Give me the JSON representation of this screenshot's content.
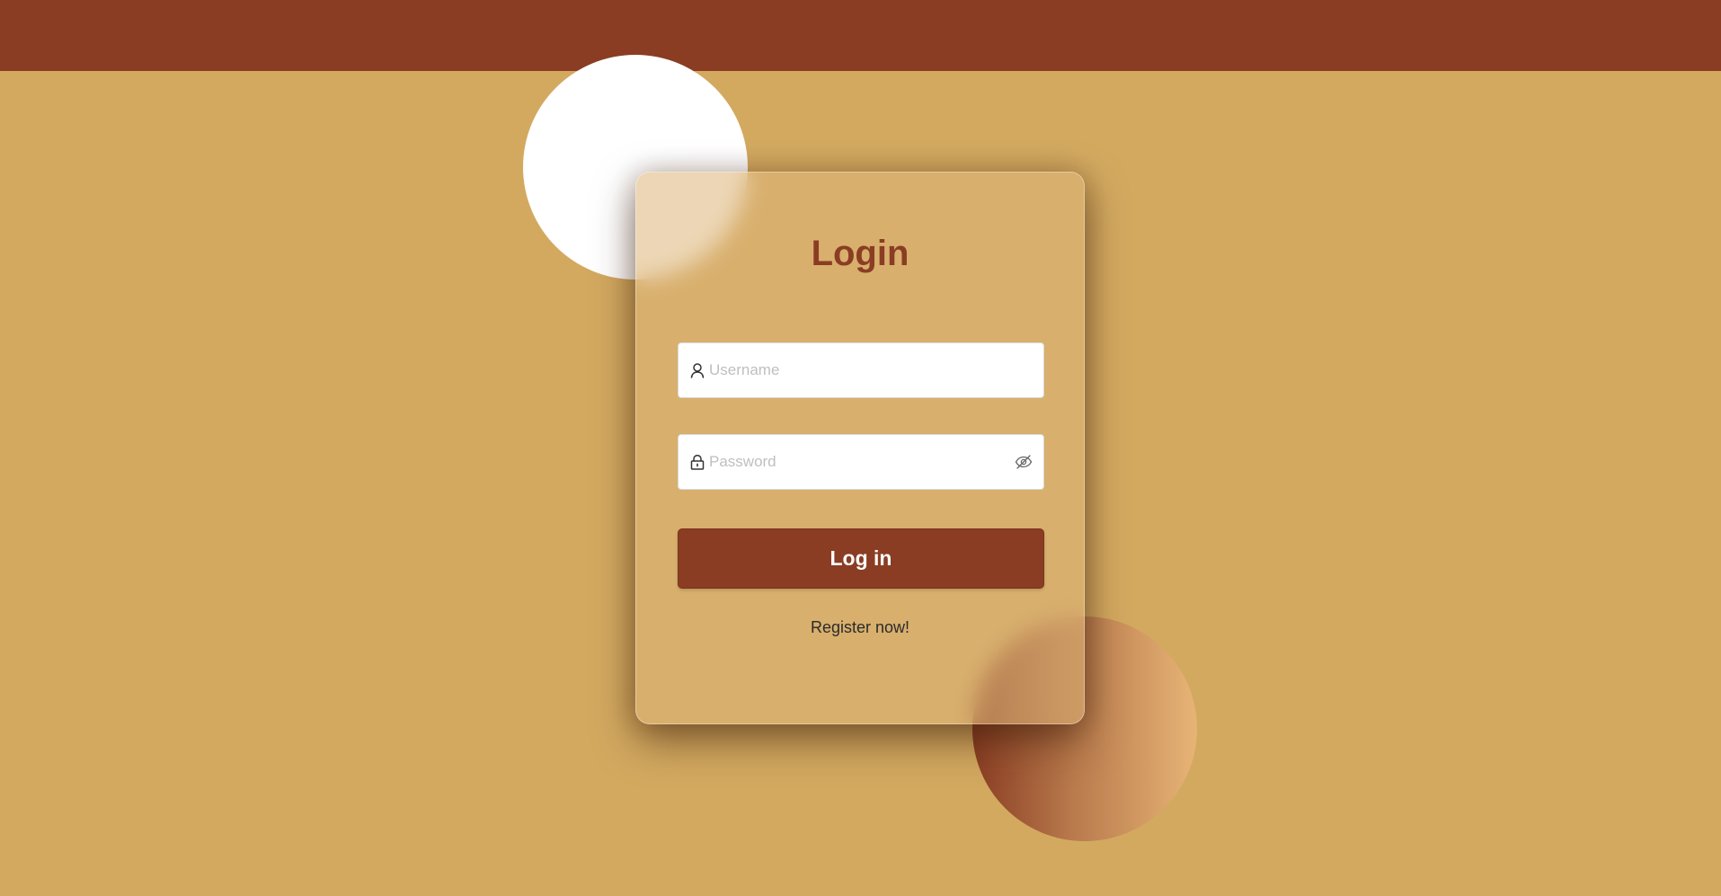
{
  "header": {
    "bar_color": "#8a3d23"
  },
  "theme": {
    "background": "#d3a960",
    "accent": "#8a3d23",
    "decor_circle_top": "#ffffff",
    "decor_circle_bottom_gradient": [
      "#8a3d23",
      "#e7b476"
    ]
  },
  "login_card": {
    "title": "Login",
    "username": {
      "placeholder": "Username",
      "value": "",
      "icon": "user-icon"
    },
    "password": {
      "placeholder": "Password",
      "value": "",
      "icon": "lock-icon",
      "toggle_icon": "eye-invisible-icon"
    },
    "submit_label": "Log in",
    "register_link": "Register now!"
  }
}
